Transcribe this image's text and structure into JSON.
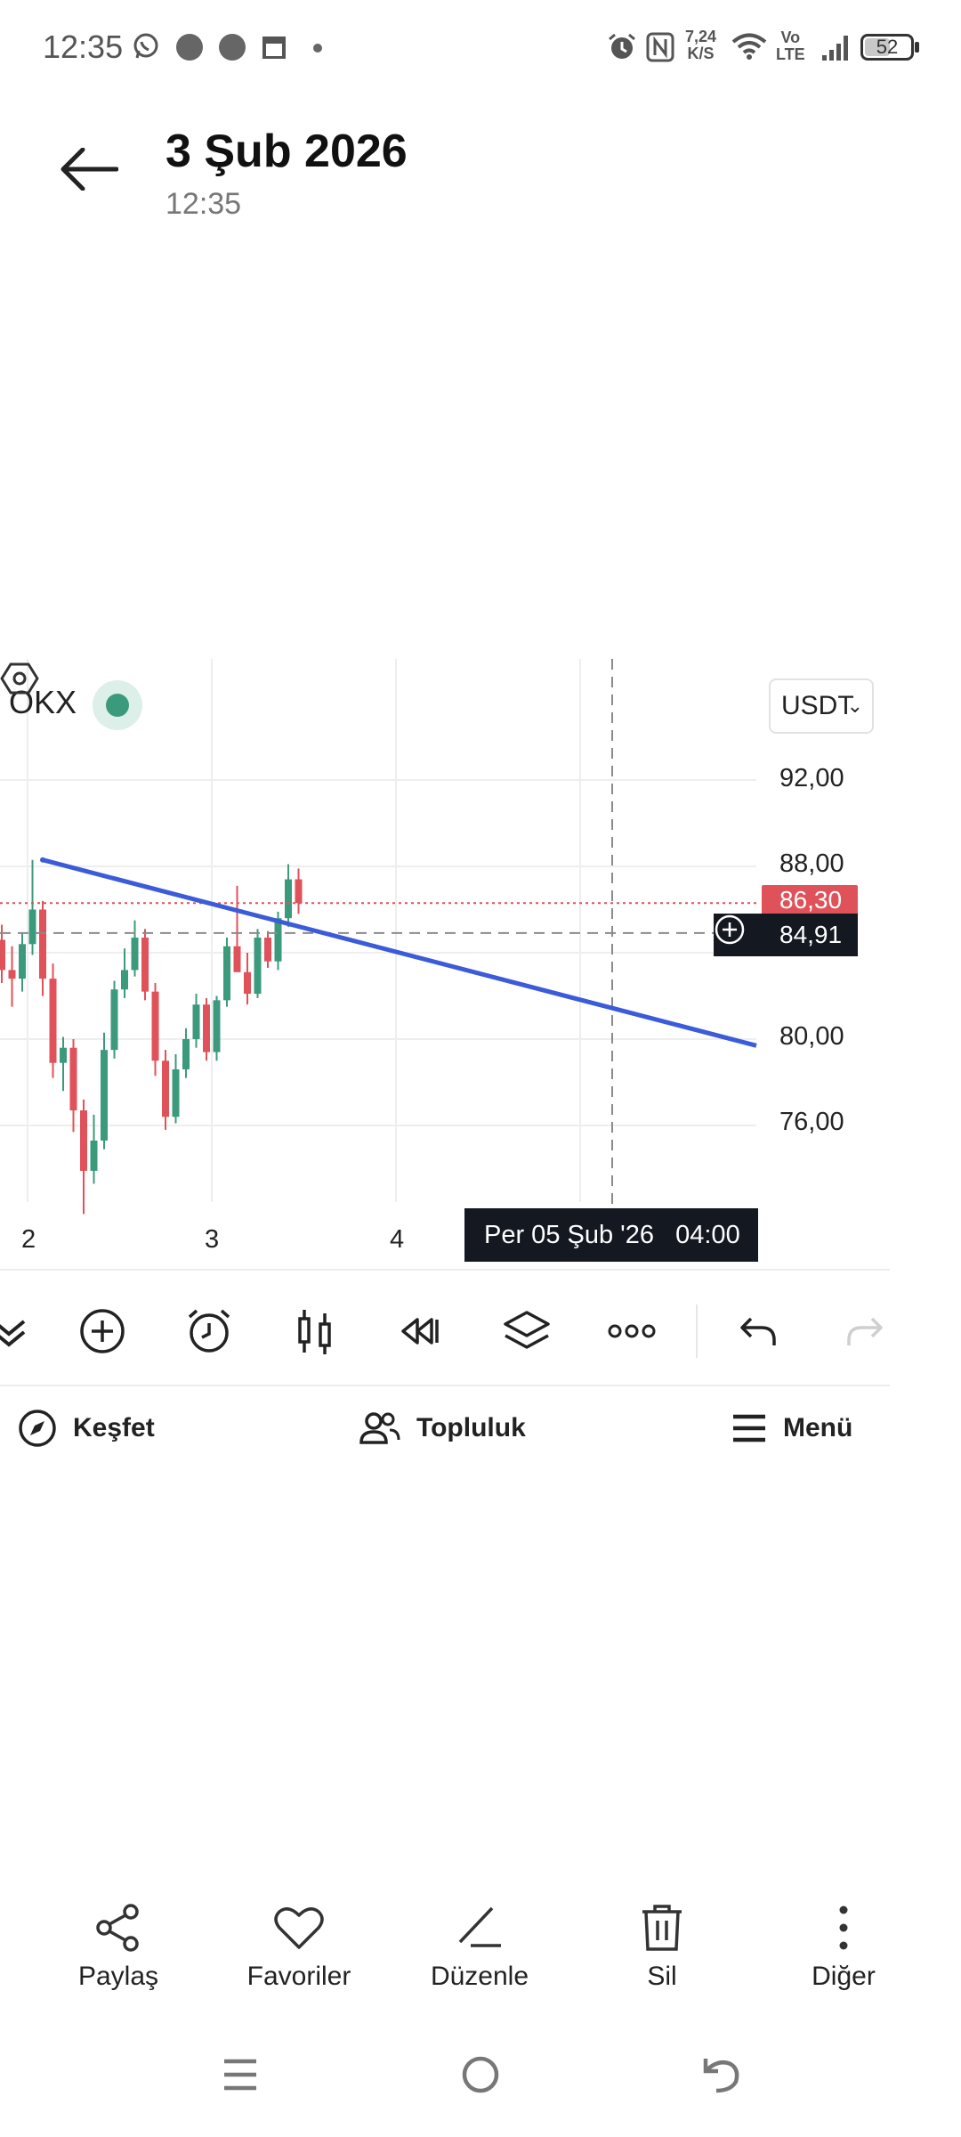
{
  "status_bar": {
    "time": "12:35",
    "net_speed_value": "7,24",
    "net_speed_unit": "K/S",
    "volte_top": "Vo",
    "volte_bottom": "LTE",
    "battery": "52"
  },
  "header": {
    "date": "3 Şub 2026",
    "time": "12:35"
  },
  "chart": {
    "exchange": "OKX",
    "currency": "USDT",
    "last_price_badge": "86,30",
    "crosshair_price_badge": "84,91",
    "crosshair_date_badge": "Per 05 Şub '26   04:00",
    "y_ticks": [
      "92,00",
      "88,00",
      "80,00",
      "76,00"
    ],
    "x_ticks": [
      "2",
      "3",
      "4"
    ],
    "colors": {
      "up": "#3c9a7c",
      "down": "#e0525a",
      "trendline": "#3b5bd9",
      "last_price_line": "#e0525a"
    }
  },
  "chart_data": {
    "type": "candlestick",
    "title": "",
    "currency": "USDT",
    "exchange": "OKX",
    "xlabel": "",
    "ylabel": "",
    "x_ticks": [
      "2",
      "3",
      "4"
    ],
    "y_ticks": [
      76,
      80,
      88,
      92
    ],
    "ylim": [
      71.5,
      93.5
    ],
    "last_price": 86.3,
    "crosshair": {
      "price": 84.91,
      "date": "Per 05 Şub '26 04:00"
    },
    "candles": [
      {
        "o": 84.6,
        "h": 85.3,
        "l": 82.6,
        "c": 83.2
      },
      {
        "o": 83.2,
        "h": 84.3,
        "l": 81.5,
        "c": 82.8
      },
      {
        "o": 82.8,
        "h": 84.9,
        "l": 82.2,
        "c": 84.4
      },
      {
        "o": 84.4,
        "h": 88.3,
        "l": 83.9,
        "c": 86.0
      },
      {
        "o": 86.0,
        "h": 86.4,
        "l": 82.0,
        "c": 82.8
      },
      {
        "o": 82.8,
        "h": 83.5,
        "l": 78.2,
        "c": 78.9
      },
      {
        "o": 78.9,
        "h": 80.1,
        "l": 77.6,
        "c": 79.6
      },
      {
        "o": 79.6,
        "h": 80.0,
        "l": 75.7,
        "c": 76.7
      },
      {
        "o": 76.7,
        "h": 77.2,
        "l": 71.9,
        "c": 73.9
      },
      {
        "o": 73.9,
        "h": 76.5,
        "l": 73.3,
        "c": 75.3
      },
      {
        "o": 75.3,
        "h": 80.3,
        "l": 74.9,
        "c": 79.5
      },
      {
        "o": 79.5,
        "h": 82.7,
        "l": 79.1,
        "c": 82.3
      },
      {
        "o": 82.3,
        "h": 84.2,
        "l": 81.9,
        "c": 83.2
      },
      {
        "o": 83.2,
        "h": 85.5,
        "l": 82.9,
        "c": 84.7
      },
      {
        "o": 84.7,
        "h": 85.1,
        "l": 81.8,
        "c": 82.2
      },
      {
        "o": 82.2,
        "h": 82.6,
        "l": 78.3,
        "c": 79.0
      },
      {
        "o": 79.0,
        "h": 79.5,
        "l": 75.8,
        "c": 76.4
      },
      {
        "o": 76.4,
        "h": 79.3,
        "l": 76.1,
        "c": 78.6
      },
      {
        "o": 78.6,
        "h": 80.5,
        "l": 78.2,
        "c": 80.0
      },
      {
        "o": 80.0,
        "h": 82.1,
        "l": 79.6,
        "c": 81.6
      },
      {
        "o": 81.6,
        "h": 81.9,
        "l": 79.0,
        "c": 79.4
      },
      {
        "o": 79.4,
        "h": 82.0,
        "l": 79.0,
        "c": 81.8
      },
      {
        "o": 81.8,
        "h": 84.7,
        "l": 81.5,
        "c": 84.3
      },
      {
        "o": 84.3,
        "h": 87.1,
        "l": 83.9,
        "c": 83.1
      },
      {
        "o": 83.1,
        "h": 84.0,
        "l": 81.6,
        "c": 82.1
      },
      {
        "o": 82.1,
        "h": 85.1,
        "l": 81.9,
        "c": 84.7
      },
      {
        "o": 84.7,
        "h": 85.0,
        "l": 83.3,
        "c": 83.6
      },
      {
        "o": 83.6,
        "h": 85.9,
        "l": 83.2,
        "c": 85.6
      },
      {
        "o": 85.6,
        "h": 88.1,
        "l": 85.2,
        "c": 87.4
      },
      {
        "o": 87.4,
        "h": 87.9,
        "l": 85.8,
        "c": 86.3
      }
    ],
    "trendline": {
      "from": {
        "x": "2",
        "y": 88.3
      },
      "to_price_at_right_edge": 79.7
    }
  },
  "toolbar": {
    "icons": [
      "chevrons-down-icon",
      "plus-circle-icon",
      "alarm-icon",
      "candles-icon",
      "replay-icon",
      "layers-icon",
      "more-horizontal-icon",
      "undo-icon",
      "redo-icon"
    ]
  },
  "app_nav": {
    "explore": "Keşfet",
    "community": "Topluluk",
    "menu": "Menü"
  },
  "actions": {
    "share": "Paylaş",
    "favorites": "Favoriler",
    "edit": "Düzenle",
    "delete": "Sil",
    "more": "Diğer"
  }
}
